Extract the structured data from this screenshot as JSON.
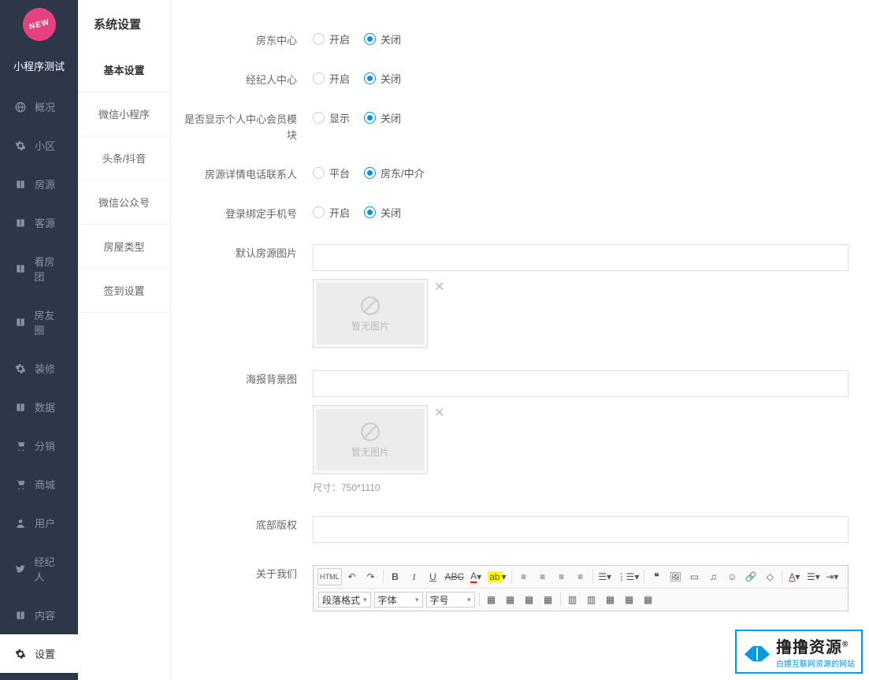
{
  "brand": "小程序测试",
  "logo": "NEW",
  "mainMenu": [
    {
      "label": "概况",
      "icon": "globe"
    },
    {
      "label": "小区",
      "icon": "gear"
    },
    {
      "label": "房源",
      "icon": "book"
    },
    {
      "label": "客源",
      "icon": "book"
    },
    {
      "label": "看房团",
      "icon": "book"
    },
    {
      "label": "房友圈",
      "icon": "book"
    },
    {
      "label": "装修",
      "icon": "gear"
    },
    {
      "label": "数据",
      "icon": "book"
    },
    {
      "label": "分销",
      "icon": "cart"
    },
    {
      "label": "商城",
      "icon": "cart"
    },
    {
      "label": "用户",
      "icon": "user"
    },
    {
      "label": "经纪人",
      "icon": "twitter"
    },
    {
      "label": "内容",
      "icon": "book"
    },
    {
      "label": "设置",
      "icon": "gear",
      "active": true
    }
  ],
  "subTitle": "系统设置",
  "subMenu": [
    {
      "label": "基本设置",
      "active": true
    },
    {
      "label": "微信小程序"
    },
    {
      "label": "头条/抖音"
    },
    {
      "label": "微信公众号"
    },
    {
      "label": "房屋类型"
    },
    {
      "label": "签到设置"
    }
  ],
  "form": {
    "landlord": {
      "label": "房东中心",
      "opt1": "开启",
      "opt2": "关闭",
      "selected": 2
    },
    "agent": {
      "label": "经纪人中心",
      "opt1": "开启",
      "opt2": "关闭",
      "selected": 2
    },
    "personal": {
      "label": "是否显示个人中心会员模块",
      "opt1": "显示",
      "opt2": "关闭",
      "selected": 2
    },
    "contact": {
      "label": "房源详情电话联系人",
      "opt1": "平台",
      "opt2": "房东/中介",
      "selected": 2
    },
    "login": {
      "label": "登录绑定手机号",
      "opt1": "开启",
      "opt2": "关闭",
      "selected": 2
    },
    "defaultImg": {
      "label": "默认房源图片",
      "placeholder": "暂无图片"
    },
    "posterBg": {
      "label": "海报背景图",
      "placeholder": "暂无图片",
      "hint": "尺寸：750*1110"
    },
    "copyright": {
      "label": "底部版权"
    },
    "about": {
      "label": "关于我们"
    }
  },
  "editor": {
    "html": "HTML",
    "para": "段落格式",
    "font": "字体",
    "size": "字号"
  },
  "watermark": {
    "title": "撸撸资源",
    "sub": "白嫖互联网资源的网站",
    "reg": "®"
  }
}
